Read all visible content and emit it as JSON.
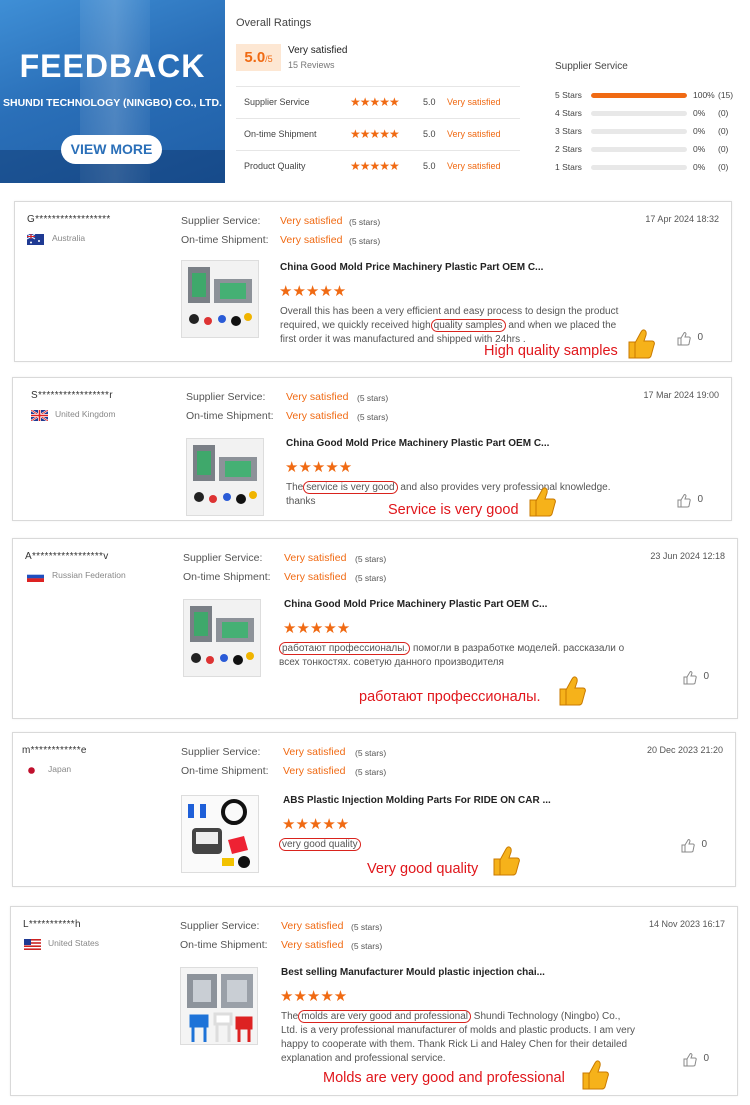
{
  "banner": {
    "title": "FEEDBACK",
    "company": "SHUNDI TECHNOLOGY (NINGBO) CO., LTD.",
    "view_more": "VIEW MORE"
  },
  "overall": {
    "title": "Overall Ratings",
    "score": "5.0",
    "score_suffix": "/5",
    "label": "Very satisfied",
    "reviews": "15 Reviews",
    "rows": [
      {
        "label": "Supplier Service",
        "stars": "★★★★★",
        "value": "5.0",
        "text": "Very satisfied"
      },
      {
        "label": "On-time Shipment",
        "stars": "★★★★★",
        "value": "5.0",
        "text": "Very satisfied"
      },
      {
        "label": "Product Quality",
        "stars": "★★★★★",
        "value": "5.0",
        "text": "Very satisfied"
      }
    ]
  },
  "supplier_service": {
    "title": "Supplier Service",
    "rows": [
      {
        "label": "5 Stars",
        "percent": "100%",
        "count": "(15)",
        "fill": 1.0
      },
      {
        "label": "4 Stars",
        "percent": "0%",
        "count": "(0)",
        "fill": 0
      },
      {
        "label": "3 Stars",
        "percent": "0%",
        "count": "(0)",
        "fill": 0
      },
      {
        "label": "2 Stars",
        "percent": "0%",
        "count": "(0)",
        "fill": 0
      },
      {
        "label": "1 Stars",
        "percent": "0%",
        "count": "(0)",
        "fill": 0
      }
    ]
  },
  "labels": {
    "supplier_service": "Supplier Service:",
    "ontime_shipment": "On-time Shipment:",
    "very_satisfied": "Very satisfied",
    "five_stars": "(5 stars)",
    "stars": "★★★★★"
  },
  "reviews": [
    {
      "user": "G******************",
      "country": "Australia",
      "date": "17 Apr 2024 18:32",
      "product": "China Good Mold Price Machinery Plastic Part OEM C...",
      "comment_before": "Overall this has been a very efficient and easy process to design the product required, we quickly received high",
      "comment_highlight": "quality samples",
      "comment_after": " and when we placed the first order it was manufactured and shipped with 24hrs .",
      "likes": "0",
      "callout": "High quality samples"
    },
    {
      "user": "S*****************r",
      "country": "United Kingdom",
      "date": "17 Mar 2024 19:00",
      "product": "China Good Mold Price Machinery Plastic Part OEM C...",
      "comment_before": "The",
      "comment_highlight": "service is very good",
      "comment_after": " and also provides very professional knowledge. thanks",
      "likes": "0",
      "callout": "Service is very good"
    },
    {
      "user": "A*****************v",
      "country": "Russian Federation",
      "date": "23 Jun 2024 12:18",
      "product": "China Good Mold Price Machinery Plastic Part OEM C...",
      "comment_before": "",
      "comment_highlight": "работают профессионалы.",
      "comment_after": " помогли в разработке моделей. рассказали о всех тонкостях. советую данного производителя",
      "likes": "0",
      "callout": "работают профессионалы."
    },
    {
      "user": "m************e",
      "country": "Japan",
      "date": "20 Dec 2023 21:20",
      "product": "ABS Plastic Injection Molding Parts For RIDE ON CAR ...",
      "comment_before": "",
      "comment_highlight": "very good quality",
      "comment_after": "",
      "likes": "0",
      "callout": "Very good quality"
    },
    {
      "user": "L***********h",
      "country": "United States",
      "date": "14 Nov 2023 16:17",
      "product": "Best selling Manufacturer Mould plastic injection chai...",
      "comment_before": "The",
      "comment_highlight": "molds are very good and professional",
      "comment_after": " Shundi Technology (Ningbo) Co., Ltd. is a very professional manufacturer of molds and plastic products. I am very happy to cooperate with them. Thank Rick Li and Haley Chen for their detailed explanation and professional service.",
      "likes": "0",
      "callout": "Molds are very good and professional"
    }
  ],
  "colors": {
    "accent": "#f06a13",
    "callout": "#e0161b",
    "banner": "#2a6fb8"
  },
  "icons": [
    "thumbs-up-icon",
    "like-icon",
    "flag-icon"
  ]
}
